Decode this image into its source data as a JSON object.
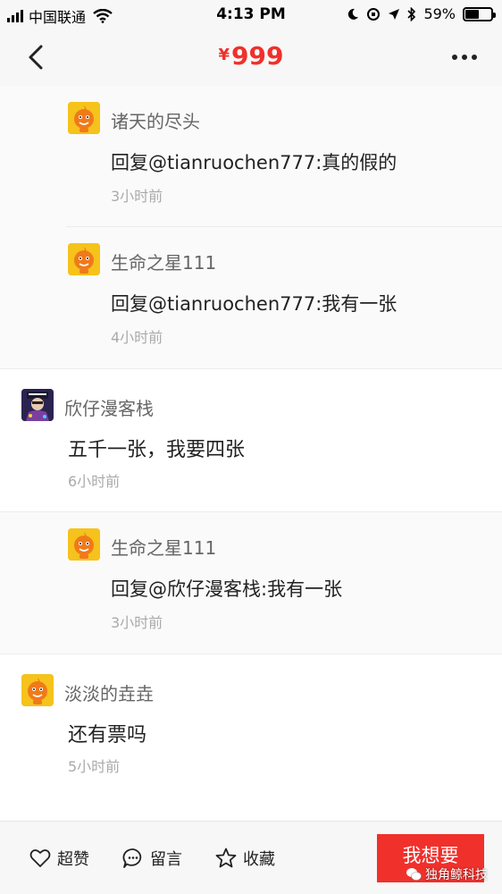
{
  "status_bar": {
    "carrier": "中国联通",
    "time": "4:13 PM",
    "battery": "59%",
    "battery_level": 0.59
  },
  "header": {
    "currency": "¥",
    "price": "999"
  },
  "comments": [
    {
      "kind": "reply",
      "user": "诸天的尽头",
      "text": "回复@tianruochen777:真的假的",
      "time": "3小时前",
      "avatar": "cartoon-avatar"
    },
    {
      "kind": "reply",
      "user": "生命之星111",
      "text": "回复@tianruochen777:我有一张",
      "time": "4小时前",
      "avatar": "cartoon-avatar"
    },
    {
      "kind": "comment",
      "user": "欣仔漫客栈",
      "text": "五千一张，我要四张",
      "time": "6小时前",
      "avatar": "photo-avatar"
    },
    {
      "kind": "reply",
      "user": "生命之星111",
      "text": "回复@欣仔漫客栈:我有一张",
      "time": "3小时前",
      "avatar": "cartoon-avatar"
    },
    {
      "kind": "comment",
      "user": "淡淡的垚垚",
      "text": "还有票吗",
      "time": "5小时前",
      "avatar": "cartoon-avatar"
    }
  ],
  "bottom_bar": {
    "like": "超赞",
    "message": "留言",
    "favorite": "收藏",
    "want": "我想要"
  },
  "watermark": "独角鲸科技",
  "colors": {
    "accent": "#f0302b",
    "avatar_bg": "#f6c21c"
  }
}
